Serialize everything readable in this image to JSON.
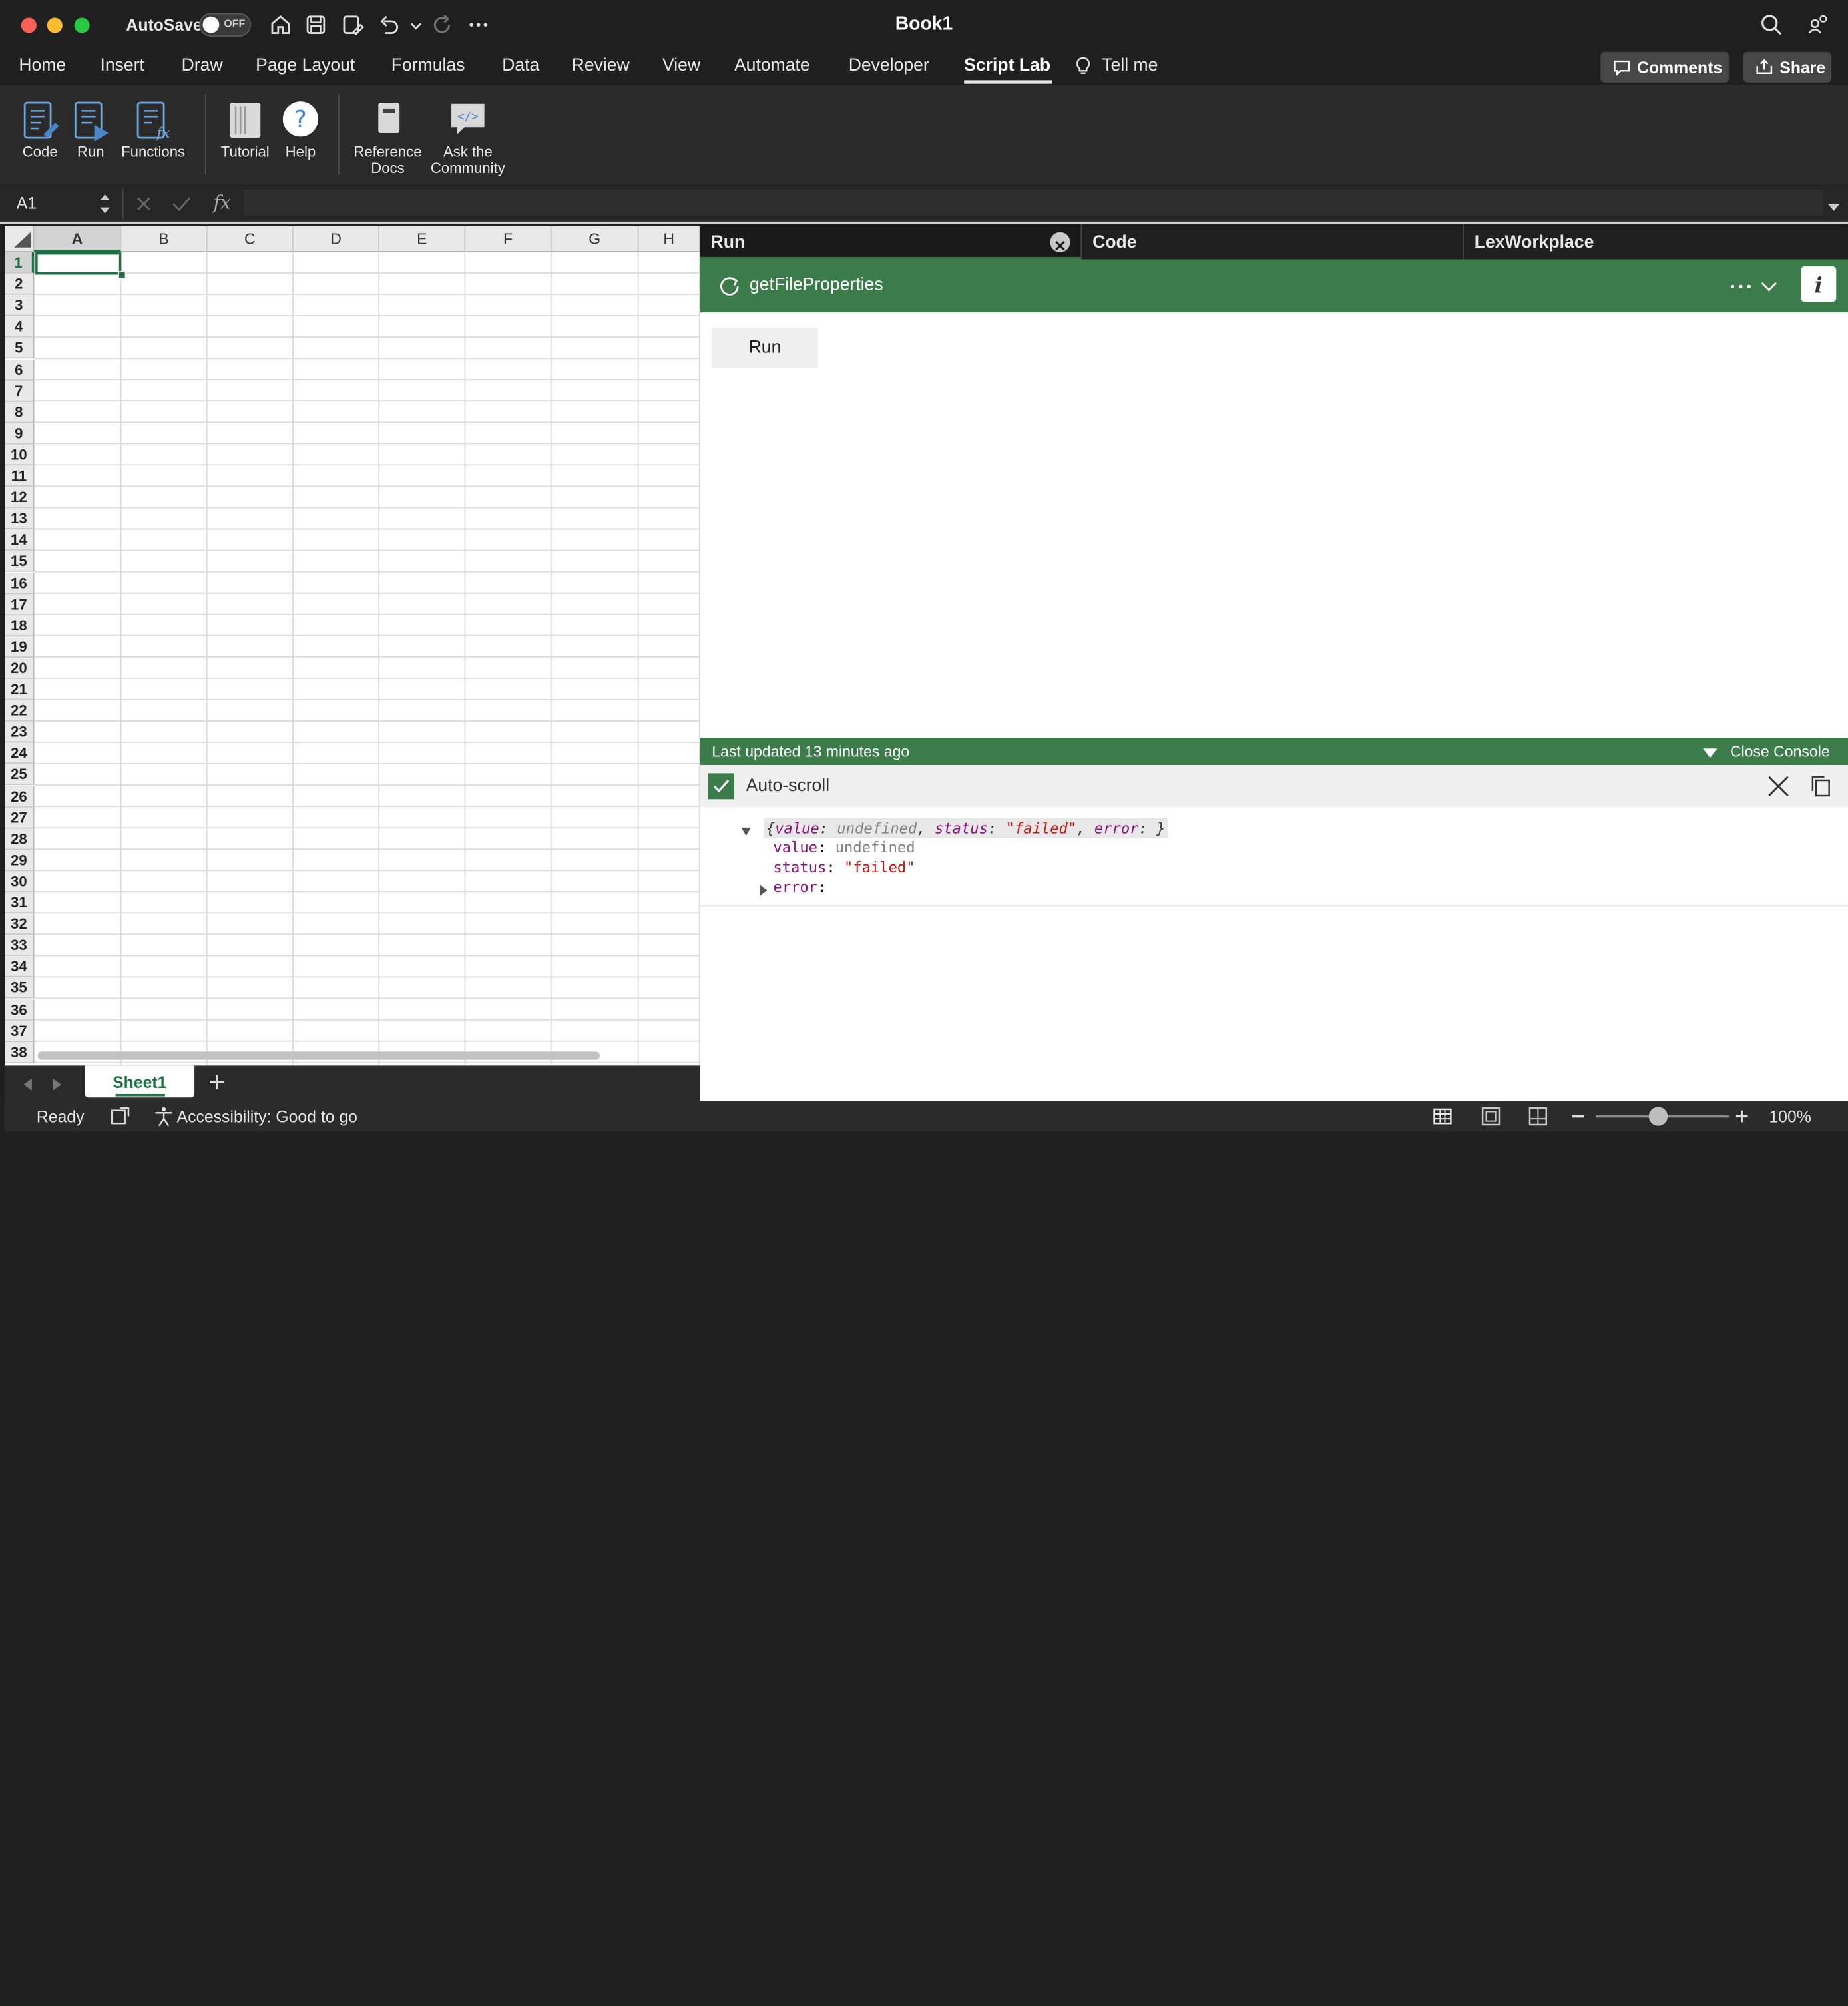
{
  "window": {
    "title": "Book1",
    "autosave_label": "AutoSave",
    "autosave_state": "OFF"
  },
  "menu": {
    "items": [
      "Home",
      "Insert",
      "Draw",
      "Page Layout",
      "Formulas",
      "Data",
      "Review",
      "View",
      "Automate",
      "Developer",
      "Script Lab"
    ],
    "active": "Script Lab",
    "tell_me": "Tell me",
    "comments_label": "Comments",
    "share_label": "Share"
  },
  "ribbon": {
    "code": "Code",
    "run": "Run",
    "functions": "Functions",
    "tutorial": "Tutorial",
    "help": "Help",
    "reference_1": "Reference",
    "reference_2": "Docs",
    "community_1": "Ask the",
    "community_2": "Community"
  },
  "formula_bar": {
    "name_box": "A1",
    "fx": "fx",
    "value": ""
  },
  "grid": {
    "columns": [
      "A",
      "B",
      "C",
      "D",
      "E",
      "F",
      "G",
      "H"
    ],
    "rows": [
      "1",
      "2",
      "3",
      "4",
      "5",
      "6",
      "7",
      "8",
      "9",
      "10",
      "11",
      "12",
      "13",
      "14",
      "15",
      "16",
      "17",
      "18",
      "19",
      "20",
      "21",
      "22",
      "23",
      "24",
      "25",
      "26",
      "27",
      "28",
      "29",
      "30",
      "31",
      "32",
      "33",
      "34",
      "35",
      "36",
      "37",
      "38"
    ],
    "selected_cell": "A1"
  },
  "sheets": {
    "tabs": [
      "Sheet1"
    ],
    "active": "Sheet1"
  },
  "status": {
    "ready": "Ready",
    "accessibility": "Accessibility: Good to go",
    "zoom": "100%"
  },
  "script_lab": {
    "tabs": [
      "Run",
      "Code",
      "LexWorkplace"
    ],
    "snippet_name": "getFileProperties",
    "run_button": "Run",
    "console": {
      "last_updated": "Last updated 13 minutes ago",
      "close_label": "Close Console",
      "autoscroll_label": "Auto-scroll",
      "summary": {
        "open": "{",
        "value_key": "value",
        "value_val": "undefined",
        "status_key": "status",
        "status_val": "\"failed\"",
        "error_key": "error",
        "close": "}"
      },
      "props": [
        {
          "key": "value",
          "val": "undefined"
        },
        {
          "key": "status",
          "val": "\"failed\""
        },
        {
          "key": "error",
          "val": ""
        }
      ]
    }
  },
  "colors": {
    "accent_green": "#3b7c4a",
    "chrome_dark": "#1f1f1f",
    "selection": "#1e7145"
  }
}
